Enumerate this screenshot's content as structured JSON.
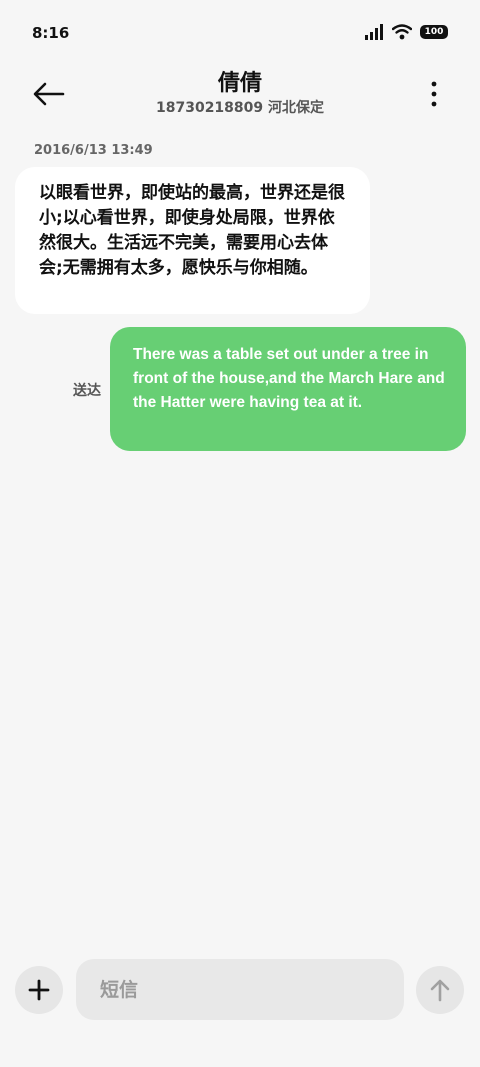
{
  "status_bar": {
    "time": "8:16",
    "battery": "100",
    "icons": [
      "signal-icon",
      "wifi-icon",
      "battery-icon"
    ]
  },
  "header": {
    "contact_name": "倩倩",
    "contact_sub": "18730218809 河北保定",
    "back_icon": "arrow-left-icon",
    "more_icon": "more-vertical-icon"
  },
  "conversation": {
    "timestamp": "2016/6/13 13:49",
    "incoming_message": "以眼看世界，即使站的最高，世界还是很小;以心看世界，即使身处局限，世界依然很大。生活远不完美，需要用心去体会;无需拥有太多，愿快乐与你相随。",
    "outgoing_message": "There was a table set out under a tree in front of the house,and the March Hare and the Hatter were having tea at it.",
    "outgoing_status": "送达"
  },
  "composer": {
    "placeholder": "短信",
    "value": "",
    "add_icon": "plus-icon",
    "send_icon": "arrow-up-icon"
  },
  "colors": {
    "background": "#f6f6f6",
    "outgoing_bubble": "#67cf74",
    "incoming_bubble": "#ffffff",
    "button_bg": "#e6e6e6"
  }
}
